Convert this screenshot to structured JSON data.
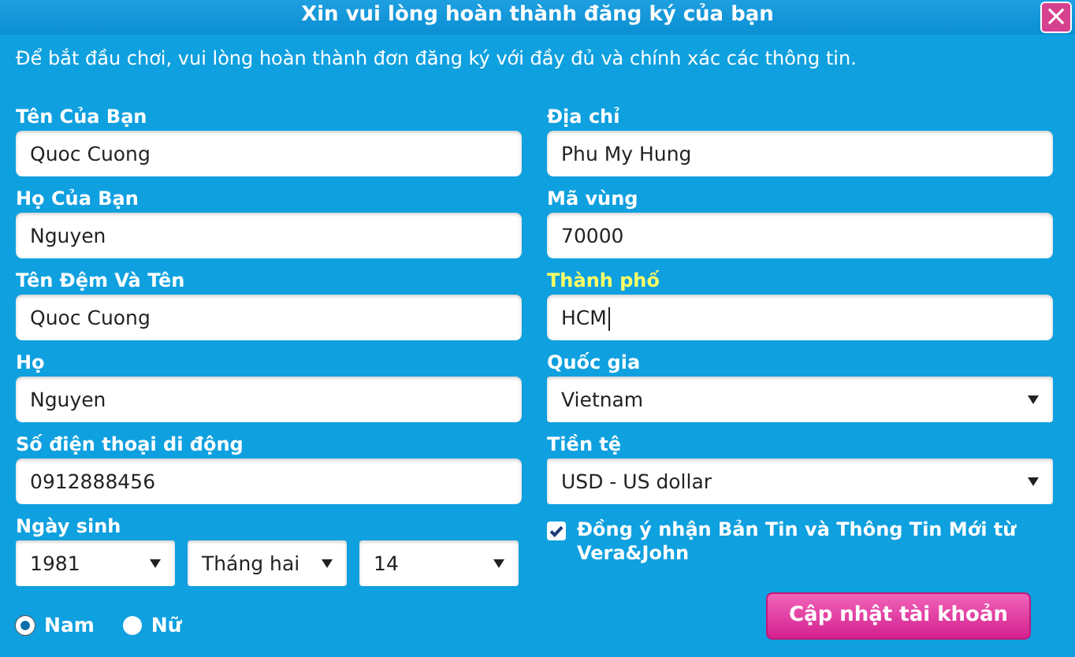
{
  "window": {
    "title": "Xin vui lòng hoàn thành đăng ký của bạn",
    "close": "×"
  },
  "intro": "Để bắt đầu chơi, vui lòng hoàn thành đơn đăng ký với đầy đủ và chính xác các thông tin.",
  "left_fields": [
    {
      "label": "Tên Của Bạn",
      "value": "Quoc Cuong",
      "kind": "text",
      "focused": false
    },
    {
      "label": "Họ Của Bạn",
      "value": "Nguyen",
      "kind": "text",
      "focused": false
    },
    {
      "label": "Tên Đệm Và Tên",
      "value": "Quoc Cuong",
      "kind": "text",
      "focused": false
    },
    {
      "label": "Họ",
      "value": "Nguyen",
      "kind": "text",
      "focused": false
    },
    {
      "label": "Số điện thoại di động",
      "value": "0912888456",
      "kind": "text",
      "focused": false
    }
  ],
  "birth_date": {
    "label": "Ngày sinh",
    "selects": [
      "1981",
      "Tháng hai",
      "14"
    ]
  },
  "gender": [
    {
      "label": "Nam",
      "selected": true
    },
    {
      "label": "Nữ",
      "selected": false
    }
  ],
  "right_fields": [
    {
      "label": "Địa chỉ",
      "value": "Phu My Hung",
      "kind": "text",
      "focused": false
    },
    {
      "label": "Mã vùng",
      "value": "70000",
      "kind": "text",
      "focused": false
    },
    {
      "label": "Thành phố",
      "value": "HCM",
      "kind": "text",
      "focused": true
    },
    {
      "label": "Quốc gia",
      "value": "Vietnam",
      "kind": "select",
      "focused": false
    },
    {
      "label": "Tiền tệ",
      "value": "USD - US dollar",
      "kind": "select",
      "focused": false
    }
  ],
  "newsletter": {
    "label": "Đồng ý nhận Bản Tin và Thông Tin Mới từ Vera&John",
    "checked": true
  },
  "submit": "Cập nhật tài khoản"
}
